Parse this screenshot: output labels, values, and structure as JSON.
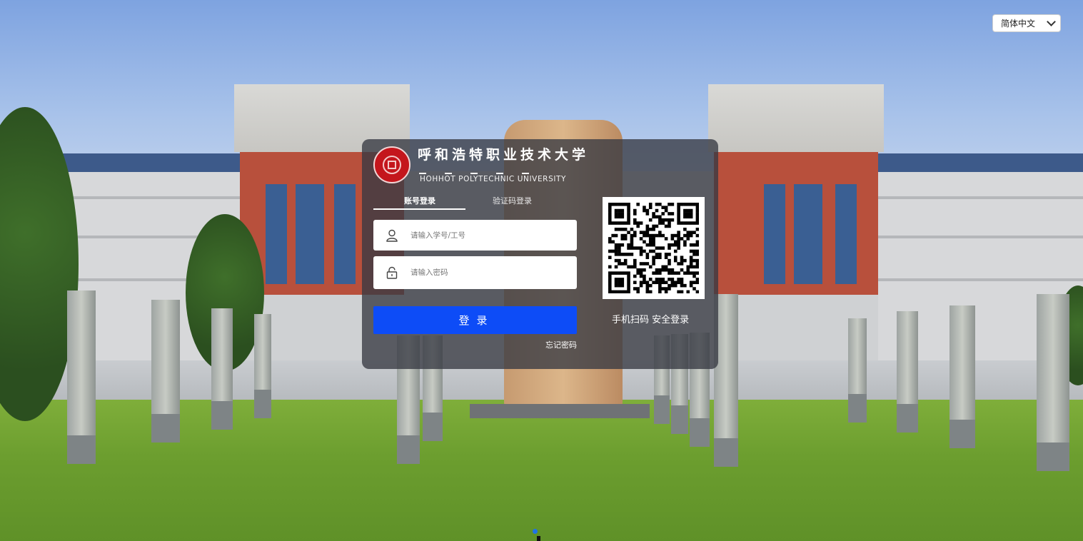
{
  "language_selector": {
    "value": "简体中文"
  },
  "university": {
    "name_cn": "呼和浩特职业技术大学",
    "name_en": "HOHHOT POLYTECHNIC UNIVERSITY"
  },
  "tabs": [
    {
      "label": "账号登录",
      "active": true
    },
    {
      "label": "验证码登录",
      "active": false
    }
  ],
  "form": {
    "username_placeholder": "请输入学号/工号",
    "password_placeholder": "请输入密码",
    "login_label": "登录",
    "forgot_label": "忘记密码"
  },
  "qr": {
    "caption": "手机扫码 安全登录"
  },
  "icons": {
    "user": "user-icon",
    "lock": "lock-icon",
    "chevron": "chevron-down-icon"
  },
  "colors": {
    "login_button": "#0d4cf7",
    "panel_overlay": "rgba(55,58,66,0.78)"
  }
}
